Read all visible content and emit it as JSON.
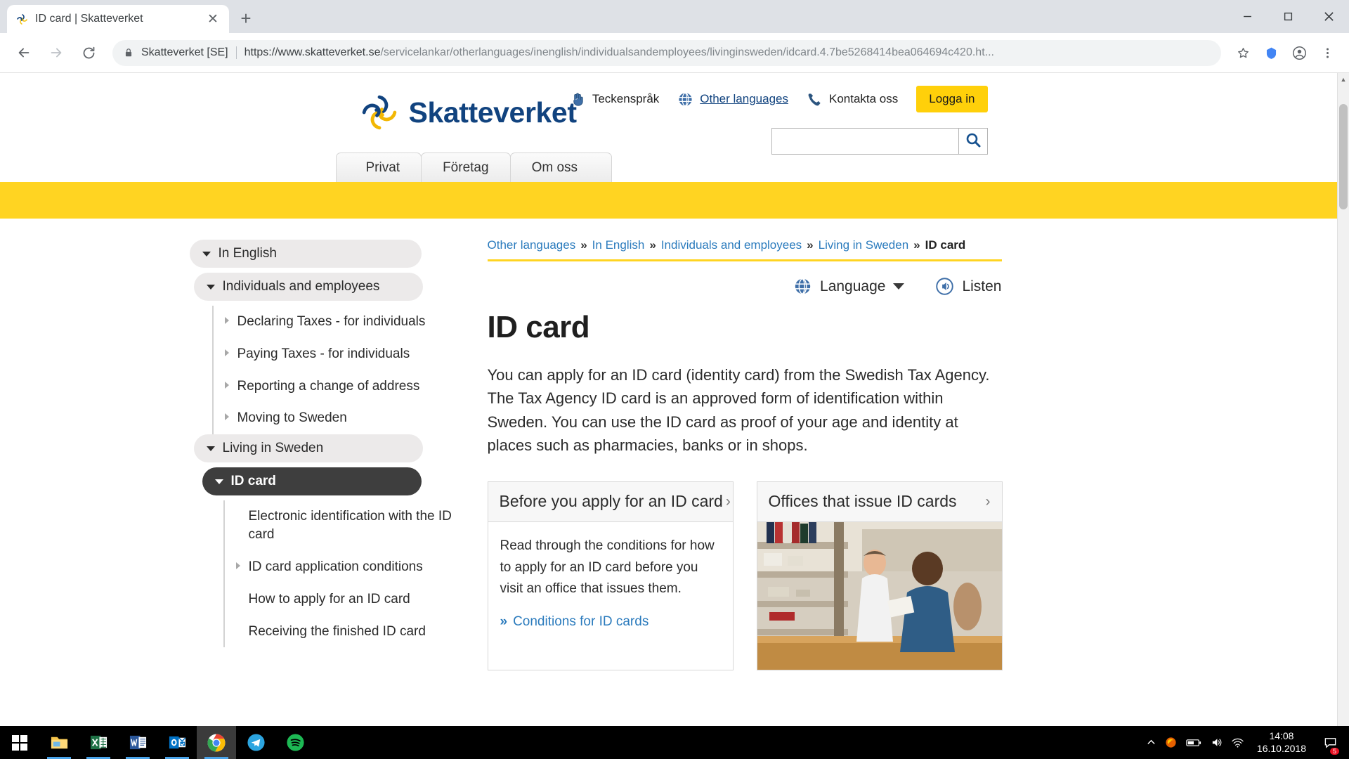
{
  "browser": {
    "tab": {
      "title": "ID card | Skatteverket",
      "favicon": "skatteverket-logo-icon",
      "close_label": "✕"
    },
    "new_tab_label": "+",
    "window_controls": {
      "minimize": "minimize-icon",
      "maximize": "maximize-icon",
      "close": "close-icon"
    },
    "omnibox": {
      "lock": "lock-icon",
      "site_name": "Skatteverket [SE]",
      "url_host": "https://www.skatteverket.se",
      "url_path": "/servicelankar/otherlanguages/inenglish/individualsandemployees/livinginsweden/idcard.4.7be5268414bea064694c420.ht...",
      "full_url": "https://www.skatteverket.se/servicelankar/otherlanguages/inenglish/individualsandemployees/livinginsweden/idcard.4.7be5268414bea064694c420.html",
      "star": "bookmark-star-icon"
    },
    "back": "back-arrow-icon",
    "forward": "forward-arrow-icon",
    "reload": "reload-icon",
    "extension": "extension-icon",
    "profile": "profile-avatar-icon",
    "menu": "three-dot-menu-icon"
  },
  "site": {
    "logo_text": "Skatteverket",
    "utility_nav": [
      {
        "label": "Teckenspråk",
        "icon": "sign-language-icon",
        "link": false
      },
      {
        "label": "Other languages",
        "icon": "globe-icon",
        "link": true
      },
      {
        "label": "Kontakta oss",
        "icon": "phone-icon",
        "link": false
      }
    ],
    "login_button": "Logga in",
    "search": {
      "value": "",
      "placeholder": "",
      "button_icon": "search-icon"
    },
    "main_nav": [
      {
        "label": "Privat"
      },
      {
        "label": "Företag"
      },
      {
        "label": "Om oss"
      }
    ],
    "accent_yellow": "#ffd422",
    "brand_blue": "#11437f",
    "link_blue": "#2b7bbd"
  },
  "sidebar": {
    "items": [
      {
        "label": "In English",
        "type": "pill",
        "level": 1,
        "marker": "triangle-down",
        "active": false
      },
      {
        "label": "Individuals and employees",
        "type": "pill",
        "level": 2,
        "marker": "triangle-down",
        "active": false
      },
      {
        "label": "Declaring Taxes - for individuals",
        "type": "leaf",
        "marker": "triangle-right"
      },
      {
        "label": "Paying Taxes - for individuals",
        "type": "leaf",
        "marker": "triangle-right"
      },
      {
        "label": "Reporting a change of address",
        "type": "leaf",
        "marker": "triangle-right"
      },
      {
        "label": "Moving to Sweden",
        "type": "leaf",
        "marker": "triangle-right"
      },
      {
        "label": "Living in Sweden",
        "type": "pill",
        "level": 2,
        "marker": "triangle-down",
        "active": false
      },
      {
        "label": "ID card",
        "type": "pill",
        "level": 3,
        "marker": "triangle-down",
        "active": true
      },
      {
        "label": "Electronic identification with the ID card",
        "type": "leaf",
        "marker": "none",
        "deep": true
      },
      {
        "label": "ID card application conditions",
        "type": "leaf",
        "marker": "triangle-right",
        "deep": true
      },
      {
        "label": "How to apply for an ID card",
        "type": "leaf",
        "marker": "none",
        "deep": true
      },
      {
        "label": "Receiving the finished ID card",
        "type": "leaf",
        "marker": "none",
        "deep": true
      }
    ]
  },
  "main": {
    "breadcrumb": [
      {
        "label": "Other languages",
        "current": false
      },
      {
        "label": "In English",
        "current": false
      },
      {
        "label": "Individuals and employees",
        "current": false
      },
      {
        "label": "Living in Sweden",
        "current": false
      },
      {
        "label": "ID card",
        "current": true
      }
    ],
    "breadcrumb_separator": "»",
    "tools": [
      {
        "label": "Language",
        "icon": "globe-icon",
        "has_chevron": true
      },
      {
        "label": "Listen",
        "icon": "listen-speaker-icon",
        "has_chevron": false
      }
    ],
    "title": "ID card",
    "intro": "You can apply for an ID card (identity card) from the Swedish Tax Agency. The Tax Agency ID card is an approved form of identification within Sweden. You can use the ID card as proof of your age and identity at places such as pharmacies, banks or in shops.",
    "cards": [
      {
        "heading": "Before you apply for an ID card",
        "arrow": "›",
        "text": "Read through the conditions for how to apply for an ID card before you visit an office that issues them.",
        "link": "Conditions for ID cards",
        "link_bullet": "»",
        "has_photo": false
      },
      {
        "heading": "Offices that issue ID cards",
        "arrow": "›",
        "text": "",
        "link": "",
        "link_bullet": "",
        "has_photo": true,
        "photo_alt": "office-counter-photo"
      }
    ]
  },
  "taskbar": {
    "start": "windows-start-icon",
    "apps": [
      {
        "name": "file-explorer-icon",
        "label": "File Explorer",
        "open": true,
        "active": false
      },
      {
        "name": "excel-icon",
        "label": "Excel",
        "open": true,
        "active": false
      },
      {
        "name": "word-icon",
        "label": "Word",
        "open": true,
        "active": false
      },
      {
        "name": "outlook-icon",
        "label": "Outlook",
        "open": true,
        "active": false
      },
      {
        "name": "chrome-icon",
        "label": "Google Chrome",
        "open": true,
        "active": true
      },
      {
        "name": "telegram-icon",
        "label": "Telegram",
        "open": false,
        "active": false
      },
      {
        "name": "spotify-icon",
        "label": "Spotify",
        "open": false,
        "active": false
      }
    ],
    "tray": [
      {
        "name": "show-hidden-icons-chevron",
        "glyph": "⌃"
      },
      {
        "name": "firefox-tray-icon",
        "glyph": ""
      },
      {
        "name": "battery-icon",
        "glyph": ""
      },
      {
        "name": "volume-icon",
        "glyph": ""
      },
      {
        "name": "network-icon",
        "glyph": ""
      }
    ],
    "clock_time": "14:08",
    "clock_date": "16.10.2018",
    "notification_count": "5"
  }
}
